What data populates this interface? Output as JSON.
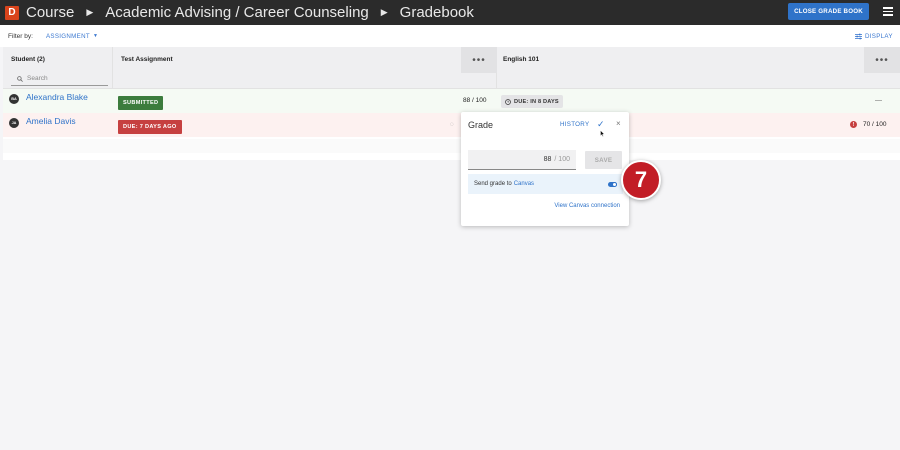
{
  "topbar": {
    "logo": "D",
    "breadcrumbs": [
      "Course",
      "Academic Advising / Career Counseling",
      "Gradebook"
    ],
    "close_label": "CLOSE GRADE BOOK"
  },
  "filter": {
    "label": "Filter by:",
    "value": "ASSIGNMENT",
    "display_label": "DISPLAY"
  },
  "table": {
    "student_header": "Student (2)",
    "search_placeholder": "Search",
    "columns": [
      "Test Assignment",
      "English 101"
    ],
    "more": "•••",
    "rows": [
      {
        "initials": "BA",
        "name": "Alexandra Blake",
        "test_badge": "SUBMITTED",
        "test_score": "88 / 100",
        "english_due": "DUE: IN 8 DAYS",
        "english_score": "—"
      },
      {
        "initials": "JA",
        "name": "Amelia Davis",
        "test_badge": "DUE: 7 DAYS AGO",
        "english_score": "70 / 100",
        "english_alert": "!"
      }
    ]
  },
  "popover": {
    "title": "Grade",
    "history": "HISTORY",
    "check": "✓",
    "close": "×",
    "grade_value": "88",
    "grade_max": "/ 100",
    "save": "SAVE",
    "sync_text": "Send grade to",
    "sync_link": "Canvas",
    "view_link": "View Canvas connection"
  },
  "step_marker": "7",
  "colors": {
    "topbar": "#2b2b2b",
    "accent": "#2f73c9",
    "submitted": "#3c7c3d",
    "overdue": "#c64040",
    "marker": "#c21d26"
  }
}
